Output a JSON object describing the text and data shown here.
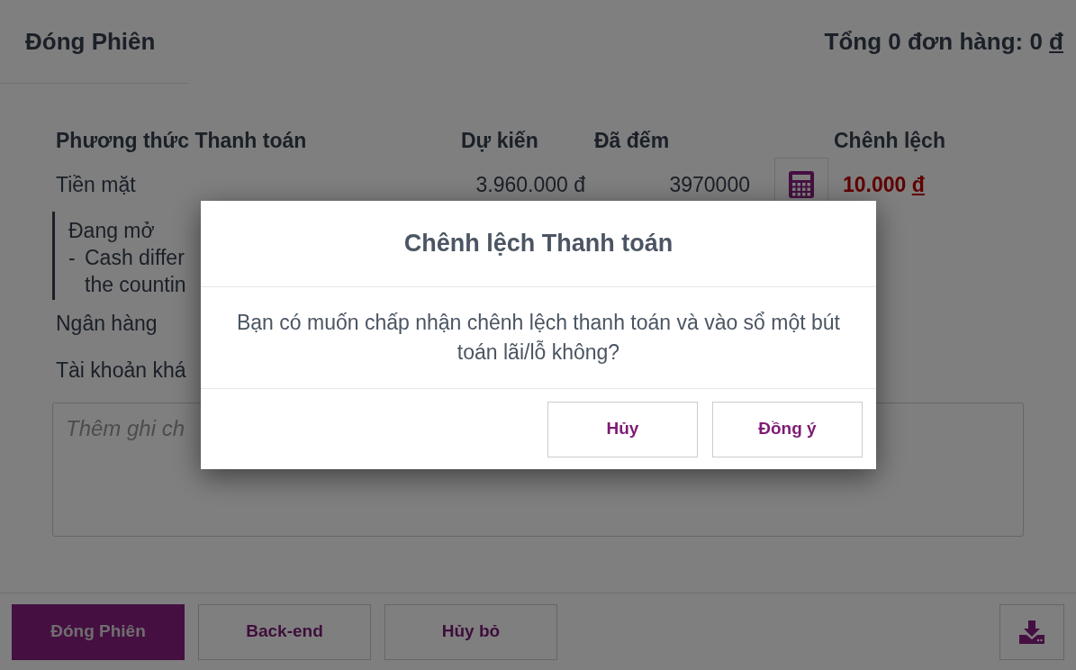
{
  "header": {
    "title": "Đóng Phiên",
    "total_text": "Tổng 0 đơn hàng: 0",
    "total_currency": "đ"
  },
  "payments": {
    "columns": [
      "Phương thức Thanh toán",
      "Dự kiến",
      "Đã đếm",
      "Chênh lệch"
    ],
    "rows": [
      {
        "kind": "counted",
        "method": "Tiền mặt",
        "expected": "3.960.000 đ",
        "counted": "3970000",
        "difference": "10.000",
        "difference_currency": "đ",
        "status": "Đang mở",
        "note_bullet": "-",
        "note_lines": [
          "Cash differ",
          "the countin"
        ]
      },
      {
        "kind": "plain",
        "method": "Ngân hàng"
      },
      {
        "kind": "plain",
        "method": "Tài khoản khá"
      }
    ]
  },
  "note_field": {
    "placeholder": "Thêm ghi ch"
  },
  "footer_buttons": [
    {
      "label": "Đóng Phiên",
      "kind": "primary"
    },
    {
      "label": "Back-end",
      "kind": "secondary"
    },
    {
      "label": "Hủy bỏ",
      "kind": "secondary"
    }
  ],
  "dialog": {
    "title": "Chênh lệch Thanh toán",
    "message": "Bạn có muốn chấp nhận chênh lệch thanh toán và vào sổ một bút toán lãi/lỗ không?",
    "buttons": [
      "Hủy",
      "Đồng ý"
    ]
  }
}
